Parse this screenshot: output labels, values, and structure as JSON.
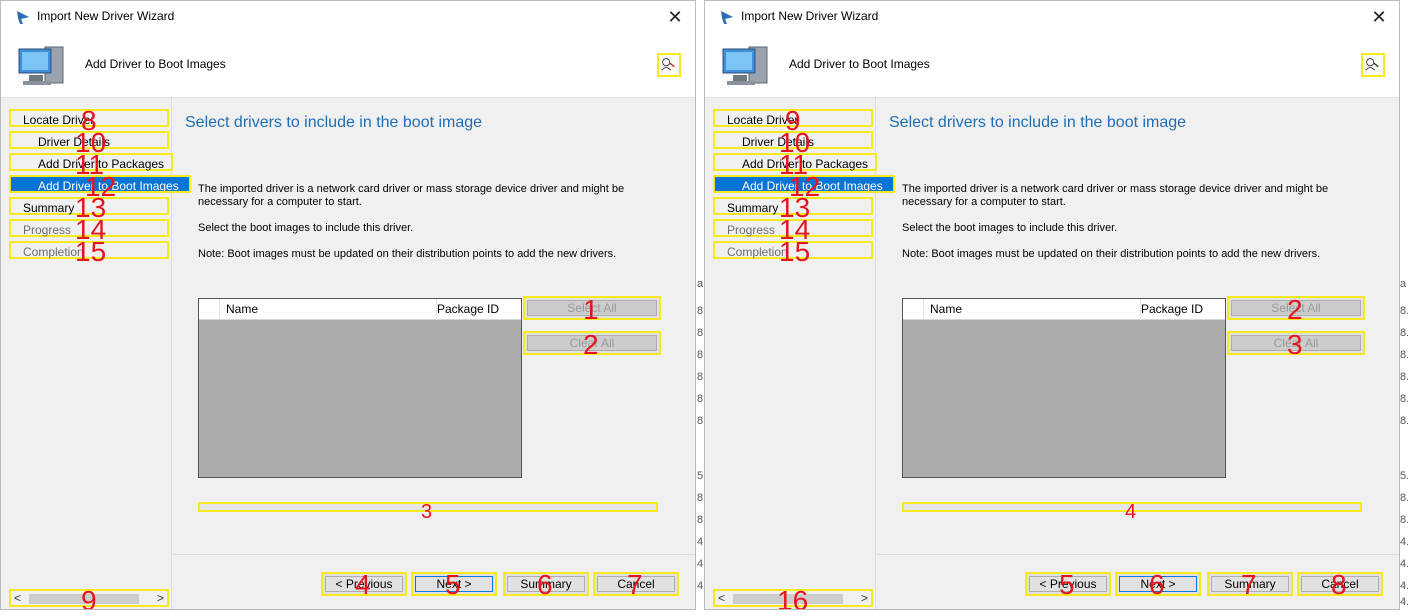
{
  "window": {
    "title": "Import New Driver Wizard",
    "close": "✕"
  },
  "header": {
    "title": "Add Driver to Boot Images"
  },
  "nav": {
    "items": [
      "Locate Driver",
      "Driver Details",
      "Add Driver to Packages",
      "Add Driver to Boot Images",
      "Summary",
      "Progress",
      "Completion"
    ],
    "scroll_left": "<",
    "scroll_right": ">"
  },
  "content": {
    "title": "Select drivers to include in the boot image",
    "desc1": "The imported driver is a network card driver or mass storage device driver and might be necessary for a computer to start.",
    "desc2": "Select the boot images to include this driver.",
    "desc3": "Note: Boot images must be updated on their distribution points to add the new drivers.",
    "list_columns": {
      "name": "Name",
      "package_id": "Package ID"
    },
    "select_all": "Select All",
    "clear_all": "Clear All"
  },
  "footer": {
    "previous": "< Previous",
    "next": "Next >",
    "summary": "Summary",
    "cancel": "Cancel"
  },
  "background_fragments": [
    "a",
    "8.",
    "8.",
    "8.",
    "8.",
    "8.",
    "8.",
    "5.",
    "8.",
    "8.",
    "4.",
    "4.",
    "4.",
    "4."
  ],
  "marks": {
    "left": {
      "select_all": "1",
      "clear_all": "2",
      "progress": "3",
      "previous": "4",
      "next": "5",
      "summary": "6",
      "cancel": "7",
      "nav_locate": "8",
      "hscroll": "9",
      "nav_details": "10",
      "nav_packages": "11",
      "nav_boot": "12",
      "nav_summary": "13",
      "nav_progress": "14",
      "nav_completion": "15"
    },
    "right": {
      "select_all": "2",
      "clear_all": "3",
      "progress": "4",
      "previous": "5",
      "next": "6",
      "summary": "7",
      "cancel": "8",
      "nav_locate": "9",
      "nav_details": "10",
      "nav_packages": "11",
      "nav_boot": "12",
      "nav_summary": "13",
      "nav_progress": "14",
      "nav_completion": "15",
      "hscroll": "16"
    }
  },
  "colors": {
    "accent": "#0a74d6",
    "title_blue": "#1e6eb8",
    "highlight": "#f5ea1e",
    "mark": "#e8141c"
  }
}
